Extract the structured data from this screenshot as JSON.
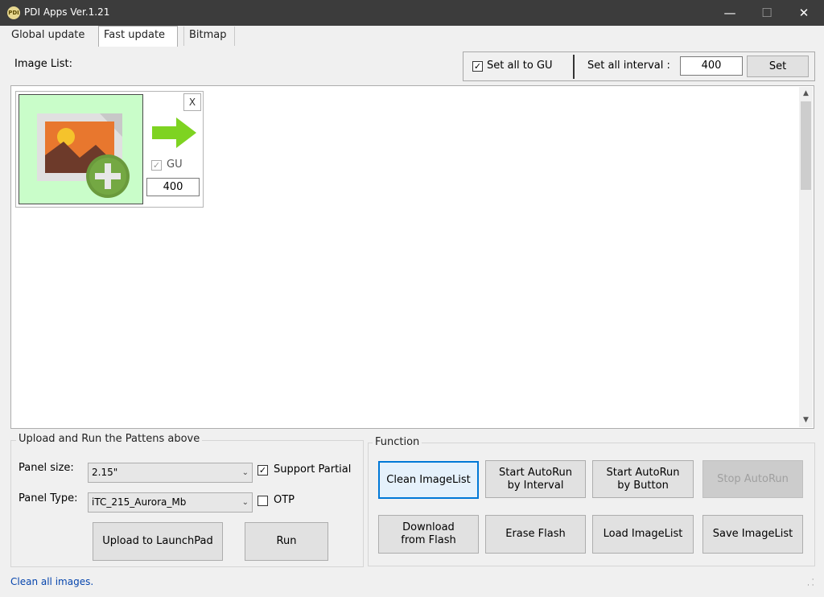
{
  "window": {
    "title": "PDI Apps Ver.1.21",
    "app_icon": "pdi-app-icon",
    "icon_text": "PDI",
    "minimize_glyph": "—",
    "maximize_glyph": "☐",
    "close_glyph": "✕"
  },
  "tabs": [
    {
      "label": "Global update",
      "selected": false
    },
    {
      "label": "Fast update",
      "selected": true
    },
    {
      "label": "Bitmap",
      "selected": false
    }
  ],
  "image_list": {
    "label": "Image List:",
    "set_all_gu_label": "Set all to GU",
    "set_all_gu_checked": true,
    "set_all_interval_label": "Set all interval :",
    "set_all_interval_value": "400",
    "set_button_label": "Set",
    "items": [
      {
        "icon": "add-image-icon",
        "arrow_icon": "green-arrow-icon",
        "remove_label": "X",
        "gu_label": "GU",
        "gu_checked": true,
        "interval": "400"
      }
    ]
  },
  "upload_group": {
    "title": "Upload and Run the Pattens above",
    "panel_size_label": "Panel size:",
    "panel_size_value": "2.15\"",
    "panel_type_label": "Panel Type:",
    "panel_type_value": "iTC_215_Aurora_Mb",
    "support_partial_label": "Support Partial",
    "support_partial_checked": true,
    "otp_label": "OTP",
    "otp_checked": false,
    "upload_button": "Upload to LaunchPad",
    "run_button": "Run"
  },
  "function_group": {
    "title": "Function",
    "clean_imagelist": "Clean ImageList",
    "start_autorun_interval_line1": "Start AutoRun",
    "start_autorun_interval_line2": "by Interval",
    "start_autorun_button_line1": "Start AutoRun",
    "start_autorun_button_line2": "by Button",
    "stop_autorun": "Stop AutoRun",
    "download_line1": "Download",
    "download_line2": "from Flash",
    "erase_flash": "Erase Flash",
    "load_imagelist": "Load ImageList",
    "save_imagelist": "Save ImageList"
  },
  "status": {
    "text": "Clean all images."
  },
  "colors": {
    "titlebar": "#3c3c3c",
    "thumb_bg": "#c9fdc9",
    "arrow_green": "#7ed321",
    "focus_blue": "#0078d7"
  }
}
